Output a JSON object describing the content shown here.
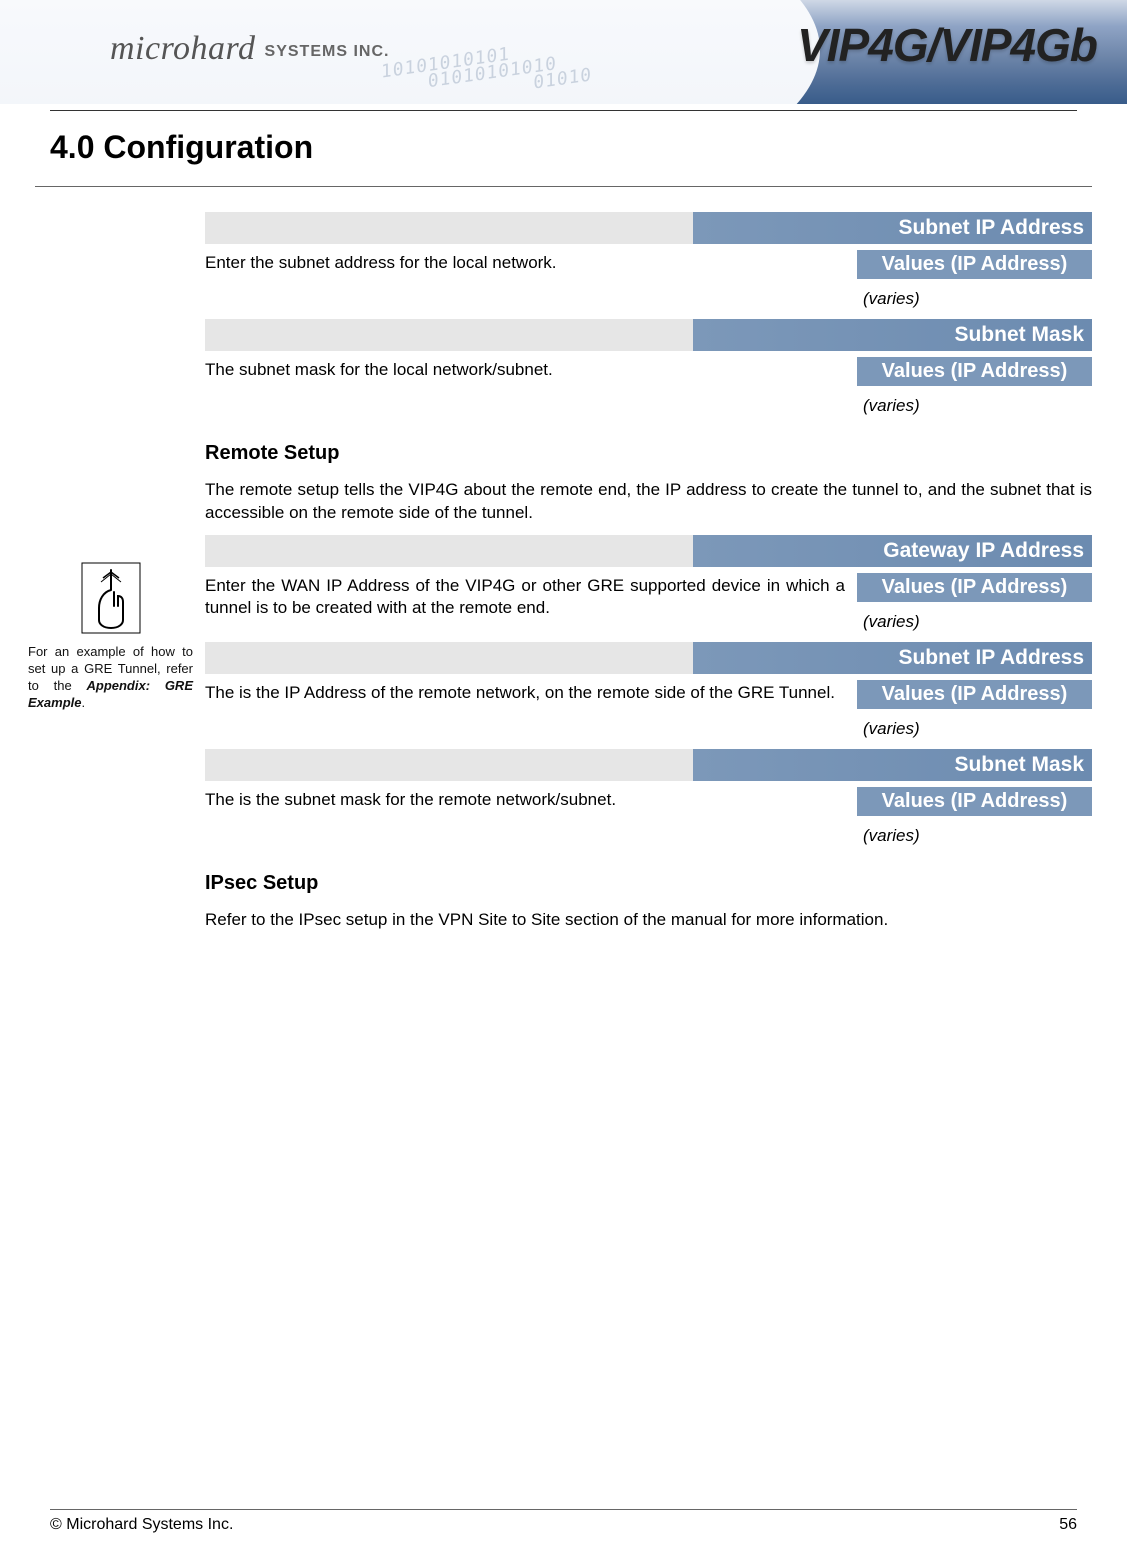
{
  "header": {
    "company_brand": "microhard",
    "company_suffix": "SYSTEMS INC.",
    "product_name": "VIP4G/VIP4Gb"
  },
  "section_number_title": "4.0  Configuration",
  "sidebar": {
    "note_part1": "For an example of how to set up a GRE Tunnel, refer to the ",
    "note_emph": "Appendix: GRE Example",
    "note_part2": "."
  },
  "params": [
    {
      "title": "Subnet IP Address",
      "desc": "Enter the subnet address for the local network.",
      "value_label": "Values (IP Address)",
      "value_note": "(varies)"
    },
    {
      "title": "Subnet Mask",
      "desc": "The subnet mask for the local network/subnet.",
      "value_label": "Values (IP Address)",
      "value_note": "(varies)"
    }
  ],
  "remote_setup": {
    "heading": "Remote Setup",
    "text": "The remote setup tells the VIP4G about the remote end, the IP address to create the tunnel to, and the subnet that is accessible on the remote side of the tunnel."
  },
  "params2": [
    {
      "title": "Gateway IP Address",
      "desc": "Enter the WAN IP Address of the VIP4G or other GRE supported device in which a tunnel is to be created with at the remote end.",
      "value_label": "Values (IP Address)",
      "value_note": "(varies)"
    },
    {
      "title": "Subnet IP Address",
      "desc": "The is the IP Address of the remote network, on the remote side of the GRE Tunnel.",
      "value_label": "Values (IP Address)",
      "value_note": "(varies)"
    },
    {
      "title": "Subnet Mask",
      "desc": "The is the subnet mask for the remote network/subnet.",
      "value_label": "Values (IP Address)",
      "value_note": "(varies)"
    }
  ],
  "ipsec_setup": {
    "heading": "IPsec Setup",
    "text": "Refer to the IPsec setup in the VPN Site to Site section of the manual for more information."
  },
  "footer": {
    "copyright": "© Microhard Systems Inc.",
    "page": "56"
  }
}
